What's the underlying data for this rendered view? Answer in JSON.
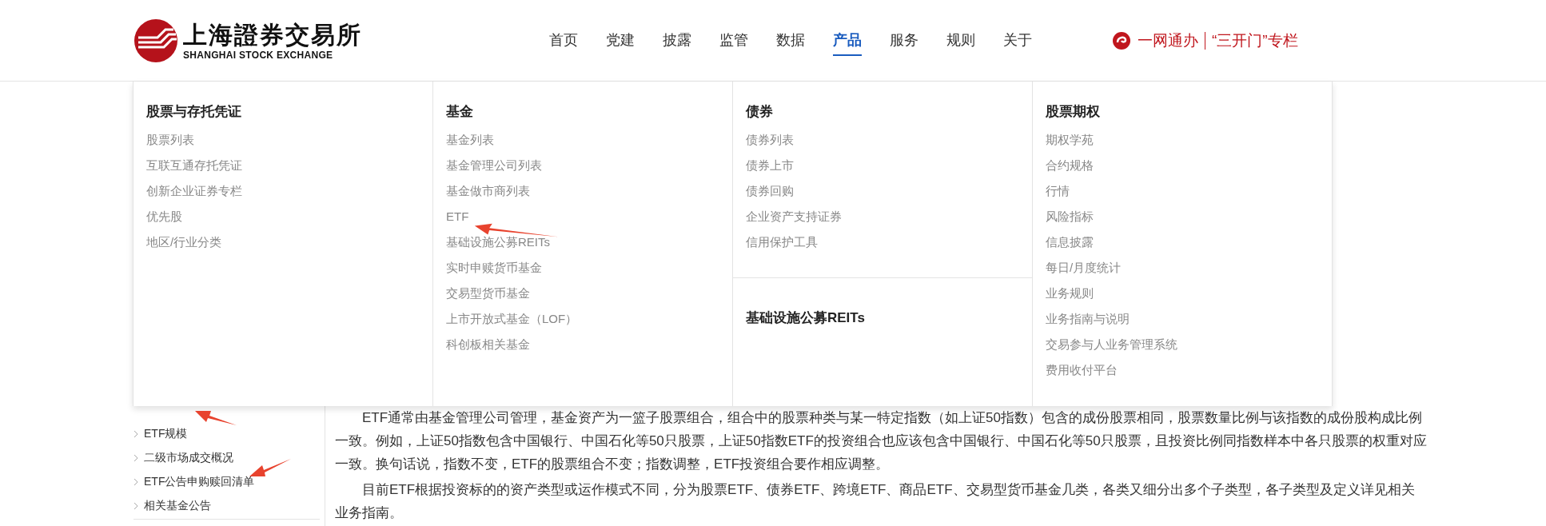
{
  "header": {
    "logo": {
      "name_cn": "上海證券交易所",
      "name_en": "SHANGHAI STOCK EXCHANGE"
    },
    "nav": [
      {
        "label": "首页",
        "selected": false
      },
      {
        "label": "党建",
        "selected": false
      },
      {
        "label": "披露",
        "selected": false
      },
      {
        "label": "监管",
        "selected": false
      },
      {
        "label": "数据",
        "selected": false
      },
      {
        "label": "产品",
        "selected": true
      },
      {
        "label": "服务",
        "selected": false
      },
      {
        "label": "规则",
        "selected": false
      },
      {
        "label": "关于",
        "selected": false
      }
    ],
    "links": [
      "一网通办",
      "“三开门”专栏"
    ]
  },
  "mega_menu": {
    "columns": [
      {
        "sections": [
          {
            "title": "股票与存托凭证",
            "items": [
              "股票列表",
              "互联互通存托凭证",
              "创新企业证券专栏",
              "优先股",
              "地区/行业分类"
            ]
          }
        ]
      },
      {
        "sections": [
          {
            "title": "基金",
            "items": [
              "基金列表",
              "基金管理公司列表",
              "基金做市商列表",
              "ETF",
              "基础设施公募REITs",
              "实时申赎货币基金",
              "交易型货币基金",
              "上市开放式基金（LOF）",
              "科创板相关基金"
            ]
          }
        ]
      },
      {
        "sections": [
          {
            "title": "债券",
            "items": [
              "债券列表",
              "债券上市",
              "债券回购",
              "企业资产支持证券",
              "信用保护工具"
            ]
          },
          {
            "title": "基础设施公募REITs"
          }
        ]
      },
      {
        "sections": [
          {
            "title": "股票期权",
            "items": [
              "期权学苑",
              "合约规格",
              "行情",
              "风险指标",
              "信息披露",
              "每日/月度统计",
              "业务规则",
              "业务指南与说明",
              "交易参与人业务管理系统",
              "费用收付平台"
            ]
          }
        ]
      }
    ]
  },
  "sidebar": {
    "items": [
      "ETF规模",
      "二级市场成交概况",
      "ETF公告申购赎回清单",
      "相关基金公告"
    ]
  },
  "article": {
    "paragraphs": [
      "ETF通常由基金管理公司管理，基金资产为一篮子股票组合，组合中的股票种类与某一特定指数（如上证50指数）包含的成份股票相同，股票数量比例与该指数的成份股构成比例一致。例如，上证50指数包含中国银行、中国石化等50只股票，上证50指数ETF的投资组合也应该包含中国银行、中国石化等50只股票，且投资比例同指数样本中各只股票的权重对应一致。换句话说，指数不变，ETF的股票组合不变；指数调整，ETF投资组合要作相应调整。",
      "目前ETF根据投资标的的资产类型或运作模式不同，分为股票ETF、债券ETF、跨境ETF、商品ETF、交易型货币基金几类，各类又细分出多个子类型，各子类型及定义详见相关业务指南。"
    ]
  }
}
